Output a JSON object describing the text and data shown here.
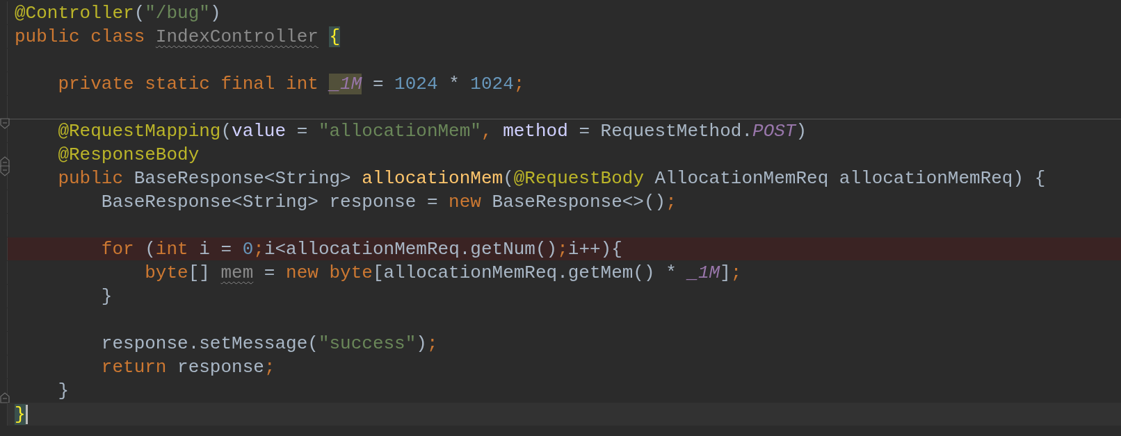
{
  "lines": [
    {
      "kind": "code",
      "tokens": [
        {
          "t": "@Controller",
          "kind": "annotation"
        },
        {
          "t": "(",
          "kind": "plain"
        },
        {
          "t": "\"/bug\"",
          "kind": "string"
        },
        {
          "t": ")",
          "kind": "plain"
        }
      ]
    },
    {
      "kind": "code",
      "tokens": [
        {
          "t": "public class ",
          "kind": "keyword"
        },
        {
          "t": "IndexController",
          "kind": "unused",
          "wavy_underline": true
        },
        {
          "t": "{",
          "kind": "brace",
          "brace_match": true,
          "space_before": true
        }
      ]
    },
    {
      "kind": "blank"
    },
    {
      "kind": "code",
      "tokens": [
        {
          "t": "    private static final int ",
          "kind": "keyword"
        },
        {
          "t": "_1M",
          "kind": "constant",
          "usage_highlight": true
        },
        {
          "t": " = ",
          "kind": "plain"
        },
        {
          "t": "1024",
          "kind": "number"
        },
        {
          "t": " * ",
          "kind": "plain"
        },
        {
          "t": "1024",
          "kind": "number"
        },
        {
          "t": ";",
          "kind": "keyword"
        }
      ]
    },
    {
      "kind": "blank"
    },
    {
      "kind": "code",
      "separator_above": true,
      "fold_start": true,
      "tokens": [
        {
          "t": "    @RequestMapping",
          "kind": "annotation"
        },
        {
          "t": "(",
          "kind": "plain"
        },
        {
          "t": "value",
          "kind": "param"
        },
        {
          "t": " = ",
          "kind": "plain"
        },
        {
          "t": "\"allocationMem\"",
          "kind": "string"
        },
        {
          "t": ", ",
          "kind": "keyword"
        },
        {
          "t": "method",
          "kind": "param"
        },
        {
          "t": " = RequestMethod.",
          "kind": "plain"
        },
        {
          "t": "POST",
          "kind": "constant"
        },
        {
          "t": ")",
          "kind": "plain"
        }
      ]
    },
    {
      "kind": "code",
      "fold_end": true,
      "tokens": [
        {
          "t": "    @ResponseBody",
          "kind": "annotation"
        }
      ]
    },
    {
      "kind": "code",
      "fold_start": true,
      "tokens": [
        {
          "t": "    public ",
          "kind": "keyword"
        },
        {
          "t": "BaseResponse<String> ",
          "kind": "plain"
        },
        {
          "t": "allocationMem",
          "kind": "method"
        },
        {
          "t": "(",
          "kind": "plain"
        },
        {
          "t": "@RequestBody",
          "kind": "annotation"
        },
        {
          "t": " AllocationMemReq allocationMemReq) {",
          "kind": "plain"
        }
      ]
    },
    {
      "kind": "code",
      "tokens": [
        {
          "t": "        BaseResponse<String> response = ",
          "kind": "plain"
        },
        {
          "t": "new ",
          "kind": "keyword"
        },
        {
          "t": "BaseResponse<>()",
          "kind": "plain"
        },
        {
          "t": ";",
          "kind": "keyword"
        }
      ]
    },
    {
      "kind": "blank"
    },
    {
      "kind": "code",
      "error_highlight": true,
      "tokens": [
        {
          "t": "        for ",
          "kind": "keyword"
        },
        {
          "t": "(",
          "kind": "plain"
        },
        {
          "t": "int ",
          "kind": "keyword"
        },
        {
          "t": "i = ",
          "kind": "plain"
        },
        {
          "t": "0",
          "kind": "number"
        },
        {
          "t": ";",
          "kind": "keyword"
        },
        {
          "t": "i<allocationMemReq.getNum()",
          "kind": "plain"
        },
        {
          "t": ";",
          "kind": "keyword"
        },
        {
          "t": "i++){",
          "kind": "plain"
        }
      ]
    },
    {
      "kind": "code",
      "tokens": [
        {
          "t": "            byte",
          "kind": "keyword"
        },
        {
          "t": "[] ",
          "kind": "plain"
        },
        {
          "t": "mem",
          "kind": "unused",
          "wavy_underline": true
        },
        {
          "t": " = ",
          "kind": "plain"
        },
        {
          "t": "new byte",
          "kind": "keyword"
        },
        {
          "t": "[allocationMemReq.getMem() * ",
          "kind": "plain"
        },
        {
          "t": "_1M",
          "kind": "constant"
        },
        {
          "t": "]",
          "kind": "plain"
        },
        {
          "t": ";",
          "kind": "keyword"
        }
      ]
    },
    {
      "kind": "code",
      "tokens": [
        {
          "t": "        }",
          "kind": "plain"
        }
      ]
    },
    {
      "kind": "blank"
    },
    {
      "kind": "code",
      "tokens": [
        {
          "t": "        response.setMessage(",
          "kind": "plain"
        },
        {
          "t": "\"success\"",
          "kind": "string"
        },
        {
          "t": ")",
          "kind": "plain"
        },
        {
          "t": ";",
          "kind": "keyword"
        }
      ]
    },
    {
      "kind": "code",
      "tokens": [
        {
          "t": "        return ",
          "kind": "keyword"
        },
        {
          "t": "response",
          "kind": "plain"
        },
        {
          "t": ";",
          "kind": "keyword"
        }
      ]
    },
    {
      "kind": "code",
      "fold_end": true,
      "tokens": [
        {
          "t": "    }",
          "kind": "plain"
        }
      ]
    },
    {
      "kind": "code",
      "current_line": true,
      "caret": true,
      "tokens": [
        {
          "t": "}",
          "kind": "brace",
          "brace_match": true
        }
      ]
    }
  ]
}
